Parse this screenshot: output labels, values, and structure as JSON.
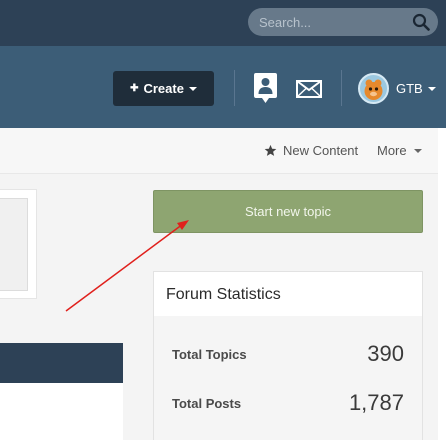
{
  "search": {
    "placeholder": "Search..."
  },
  "navbar": {
    "create_label": "Create",
    "create_prefix": "✚",
    "user_label": "GTB"
  },
  "subnav": {
    "new_content_label": "New Content",
    "more_label": "More"
  },
  "main": {
    "start_topic_label": "Start new topic"
  },
  "forum_statistics": {
    "title": "Forum Statistics",
    "rows": [
      {
        "label": "Total Topics",
        "value": "390"
      },
      {
        "label": "Total Posts",
        "value": "1,787"
      }
    ]
  },
  "icons": {
    "search": "search-icon",
    "profile": "profile-card-icon",
    "mail": "mail-icon",
    "star": "star-icon",
    "avatar": "user-avatar"
  },
  "colors": {
    "topbar": "#2d4156",
    "navbar": "#3c5d77",
    "create_button": "#1f2d3a",
    "start_button": "#8ea571",
    "annotation_arrow": "#e0201c"
  }
}
